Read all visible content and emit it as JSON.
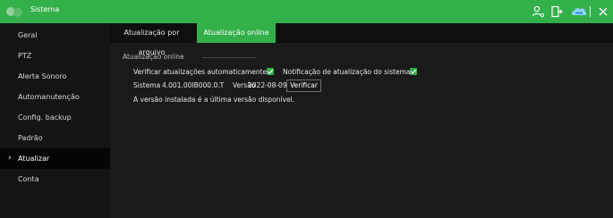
{
  "app": {
    "title": "Sistema",
    "accent_color": "#33b04a"
  },
  "toolbar_icons": [
    "user-icon",
    "logout-icon",
    "cloud-icon",
    "close-icon"
  ],
  "sidebar": {
    "items": [
      {
        "label": "Geral"
      },
      {
        "label": "PTZ"
      },
      {
        "label": "Alerta Sonoro"
      },
      {
        "label": "Automanutenção"
      },
      {
        "label": "Config. backup"
      },
      {
        "label": "Padrão"
      },
      {
        "label": "Atualizar",
        "active": true,
        "indicator": "›"
      },
      {
        "label": "Conta"
      }
    ]
  },
  "tabs": [
    {
      "label": "Atualização por arquivo",
      "active": false
    },
    {
      "label": "Atualização online",
      "active": true
    }
  ],
  "online_update": {
    "section_title": "Atualização online",
    "auto_check_label": "Verificar atualizações automaticamente",
    "auto_check_checked": true,
    "notify_label": "Notificação de atualização do sistema",
    "notify_checked": true,
    "system_label": "Sistema",
    "system_value": "4.001.00IB000.0.T",
    "version_label": "Versão",
    "version_value": "2022-08-09",
    "check_button": "Verificar",
    "status": "A versão instalada é a última versão disponível."
  }
}
